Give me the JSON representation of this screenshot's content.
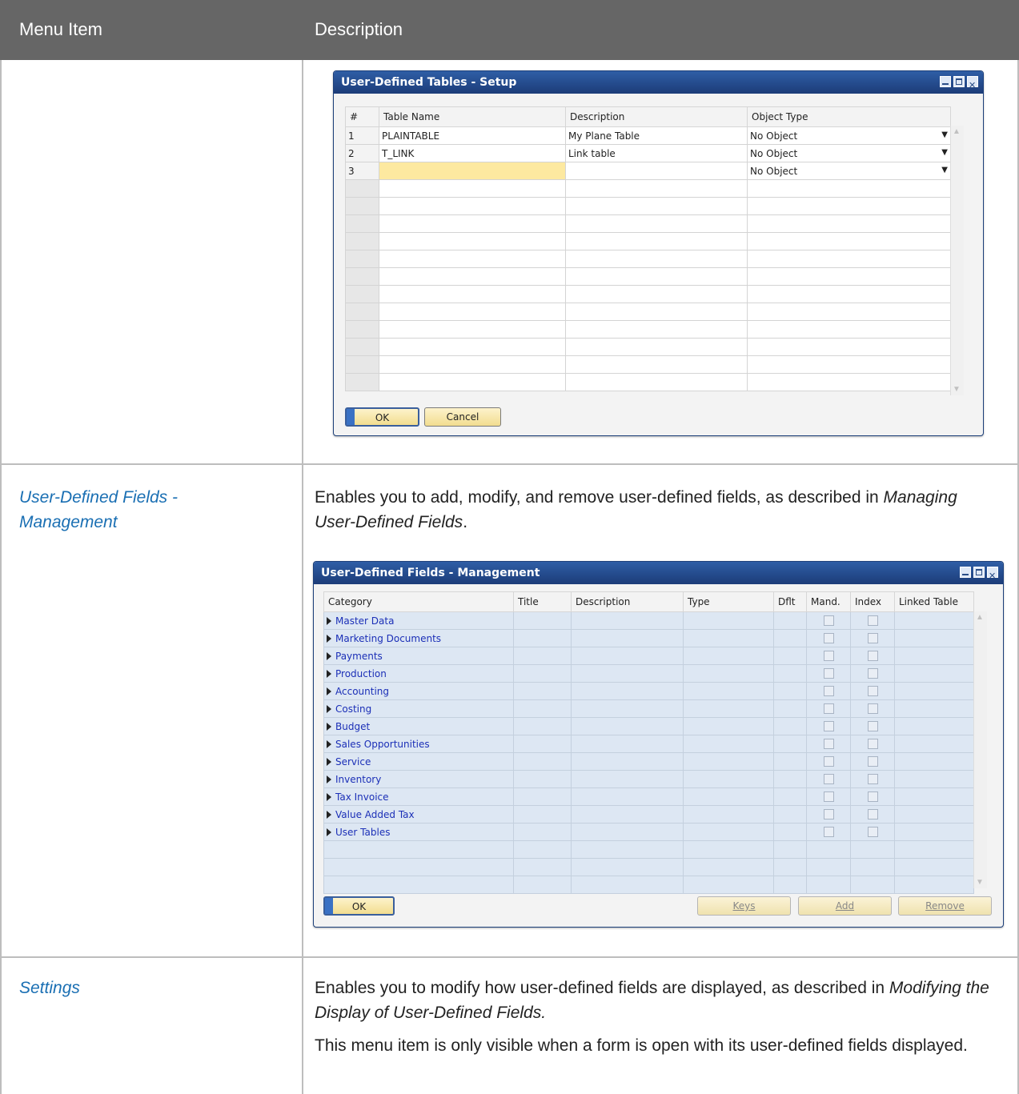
{
  "header": {
    "col1": "Menu Item",
    "col2": "Description"
  },
  "rows": [
    {
      "menu_item_line1": "User-Defined Fields -",
      "menu_item_line2": "Management",
      "desc_pre": "Enables you to add, modify, and remove user-defined fields, as described in",
      "desc_link": "Managing User-Defined Fields",
      "desc_post": "."
    },
    {
      "menu_item": "Settings",
      "desc_pre": "Enables you to modify how user-defined fields are displayed, as described in",
      "desc_link": "Modifying the Display of User-Defined Fields.",
      "desc2": "This menu item is only visible when a form is open with its user-defined fields displayed."
    }
  ],
  "udt_window": {
    "title": "User-Defined Tables - Setup",
    "columns": [
      "#",
      "Table Name",
      "Description",
      "Object Type"
    ],
    "rows": [
      {
        "num": "1",
        "name": "PLAINTABLE",
        "desc": "My Plane Table",
        "type": "No Object"
      },
      {
        "num": "2",
        "name": "T_LINK",
        "desc": "Link table",
        "type": "No Object"
      },
      {
        "num": "3",
        "name": "",
        "desc": "",
        "type": "No Object"
      }
    ],
    "empty_rows": 12,
    "ok_label": "OK",
    "cancel_label": "Cancel"
  },
  "udf_window": {
    "title": "User-Defined Fields - Management",
    "columns": [
      "Category",
      "Title",
      "Description",
      "Type",
      "Dflt",
      "Mand.",
      "Index",
      "Linked Table"
    ],
    "categories": [
      "Master Data",
      "Marketing Documents",
      "Payments",
      "Production",
      "Accounting",
      "Costing",
      "Budget",
      "Sales Opportunities",
      "Service",
      "Inventory",
      "Tax Invoice",
      "Value Added Tax",
      "User Tables"
    ],
    "empty_rows": 3,
    "ok_label": "OK",
    "keys_label": "Keys",
    "add_label": "Add",
    "remove_label": "Remove"
  }
}
